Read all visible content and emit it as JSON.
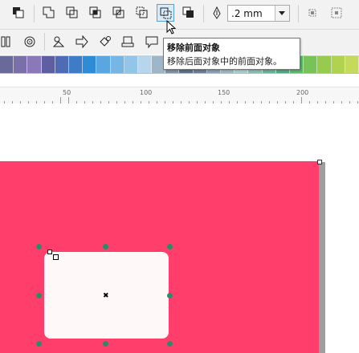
{
  "toolbar": {
    "outline_width": ".2 mm"
  },
  "ruler": {
    "labels": [
      "50",
      "100",
      "150",
      "200"
    ]
  },
  "tooltip": {
    "title": "移除前面对象",
    "description": "移除后面对象中的前面对象。"
  },
  "palette": {
    "colors": [
      "#6a6a9a",
      "#7b6fa8",
      "#8a78b8",
      "#5e5ea2",
      "#4f6bb3",
      "#3f7cc6",
      "#2e8bd6",
      "#5aa6e0",
      "#77b5e4",
      "#93c5e8",
      "#b7d5ec",
      "#9fb5c8",
      "#7d93a8",
      "#5b7287",
      "#6a8199",
      "#8aa0b6",
      "#9db7c9",
      "#aacfd0",
      "#86c0b0",
      "#66b49a",
      "#4faa7f",
      "#5cb86b",
      "#78c25a",
      "#96cb4d",
      "#b1d250",
      "#c5da5c"
    ]
  },
  "colors": {
    "page_fill": "#ff3e6c",
    "object_fill": "#fff8f9",
    "handle": "#2f8a6a",
    "active_button": "#5aa0d8"
  },
  "icons": [
    "arrange-to-front-icon",
    "weld-icon",
    "trim-icon",
    "intersect-icon",
    "simplify-icon",
    "front-minus-back-icon",
    "back-minus-front-icon",
    "create-boundary-icon",
    "outline-pen-icon",
    "wrap-text-icon",
    "contour-icon",
    "spiral-icon",
    "shapes-icon",
    "arrow-shapes-icon",
    "flowchart-icon",
    "banner-icon",
    "callout-icon"
  ]
}
